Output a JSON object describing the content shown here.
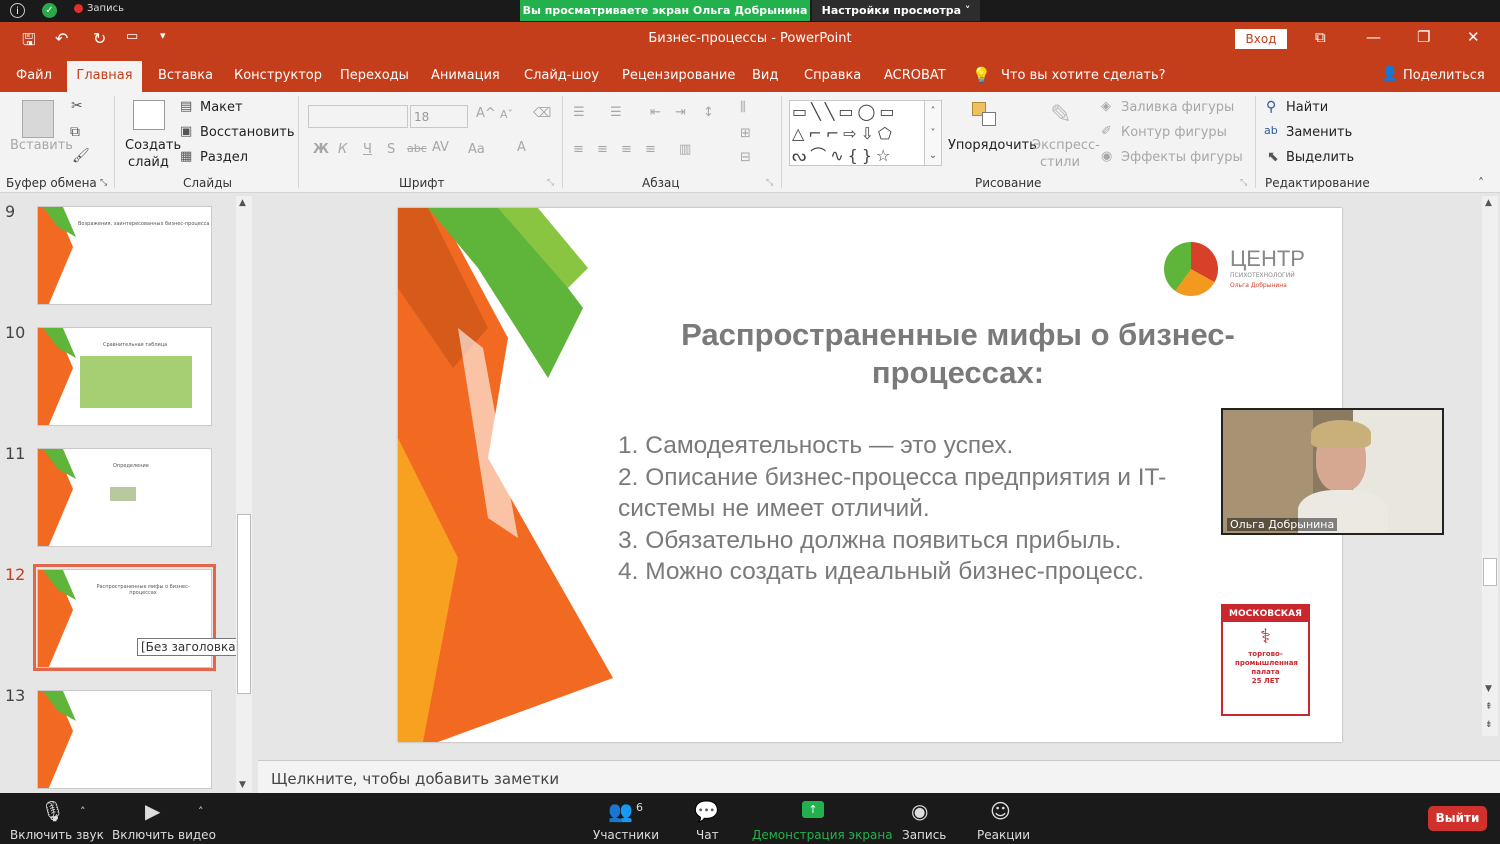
{
  "zoom": {
    "recording": "Запись",
    "share_banner": "Вы просматриваете экран Ольга Добрынина",
    "view_settings": "Настройки просмотра ˅",
    "bottom": {
      "mic": "Включить звук",
      "video": "Включить видео",
      "participants": "Участники",
      "participants_count": "6",
      "chat": "Чат",
      "share": "Демонстрация экрана",
      "record": "Запись",
      "reactions": "Реакции",
      "exit": "Выйти"
    },
    "video_name": "Ольга Добрынина"
  },
  "ppt": {
    "window_title": "Бизнес-процессы  -  PowerPoint",
    "signin": "Вход",
    "tabs": [
      "Файл",
      "Главная",
      "Вставка",
      "Конструктор",
      "Переходы",
      "Анимация",
      "Слайд-шоу",
      "Рецензирование",
      "Вид",
      "Справка",
      "ACROBAT"
    ],
    "tellme": "Что вы хотите сделать?",
    "share": "Поделиться",
    "ribbon": {
      "paste": "Вставить",
      "clipboard_group": "Буфер обмена",
      "new_slide_line1": "Создать",
      "new_slide_line2": "слайд",
      "layout": "Макет",
      "reset": "Восстановить",
      "section": "Раздел",
      "slides_group": "Слайды",
      "font_size": "18",
      "font_group": "Шрифт",
      "paragraph_group": "Абзац",
      "arrange": "Упорядочить",
      "quick_styles_line1": "Экспресс-",
      "quick_styles_line2": "стили",
      "shape_fill": "Заливка фигуры",
      "shape_outline": "Контур фигуры",
      "shape_effects": "Эффекты фигуры",
      "drawing_group": "Рисование",
      "find": "Найти",
      "replace": "Заменить",
      "select": "Выделить",
      "editing_group": "Редактирование"
    },
    "thumbnails": [
      {
        "num": "9",
        "title": "Возражения, заинтересованных бизнес-процесса"
      },
      {
        "num": "10",
        "title": "Сравнительная таблица"
      },
      {
        "num": "11",
        "title": "Определение"
      },
      {
        "num": "12",
        "title": "Распространенные мифы о бизнес-процессах"
      },
      {
        "num": "13",
        "title": ""
      }
    ],
    "tooltip": "[Без заголовка]",
    "slide": {
      "logo_name": "ЦЕНТР",
      "logo_sub": "ПСИХОТЕХНОЛОГИЙ",
      "logo_sub2": "Ольга Добрынина",
      "title": "Распространенные мифы о бизнес-процессах:",
      "items": [
        "1. Самодеятельность — это успех.",
        "2. Описание бизнес-процесса предприятия и IT-системы не имеет отличий.",
        "3. Обязательно должна появиться прибыль.",
        "4. Можно создать идеальный бизнес-процесс."
      ],
      "badge_top": "МОСКОВСКАЯ",
      "badge_text": "торгово-промышленная палата",
      "badge_years": "25 ЛЕТ"
    },
    "notes_placeholder": "Щелкните, чтобы добавить заметки"
  },
  "colors": {
    "accent": "#c43e1c",
    "zoom_green": "#22b14c",
    "exit_red": "#d0312d",
    "selection": "#e2674a"
  }
}
